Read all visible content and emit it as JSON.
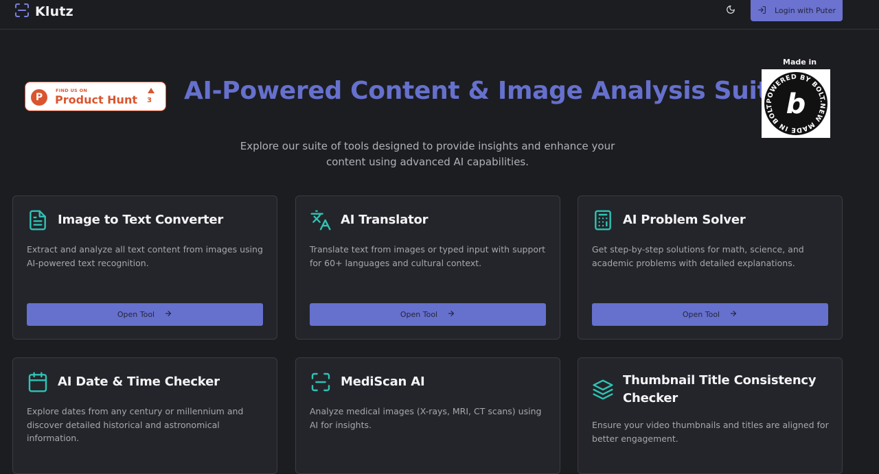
{
  "header": {
    "brand_name": "Klutz",
    "brand_icon": "scan-icon",
    "theme_icon": "moon-icon",
    "login_label": "Login with Puter",
    "login_icon": "login-icon"
  },
  "product_hunt": {
    "top_text": "FIND US ON",
    "name": "Product Hunt",
    "count": "3"
  },
  "hero": {
    "title": "AI-Powered Content & Image Analysis Suite",
    "subtitle": "Explore our suite of tools designed to provide insights and enhance your content using advanced AI capabilities."
  },
  "bolt": {
    "made_in": "Made in",
    "badge_text": "POWERED BY BOLT.NEW MADE IN BOLT.NEW"
  },
  "colors": {
    "accent": "#6670cd",
    "icon_teal": "#2ec4b6",
    "background": "#1c1d21",
    "card": "#23252a"
  },
  "cards": [
    {
      "title": "Image to Text Converter",
      "icon": "document-icon",
      "description": "Extract and analyze all text content from images using AI-powered text recognition.",
      "button": "Open Tool"
    },
    {
      "title": "AI Translator",
      "icon": "translate-icon",
      "description": "Translate text from images or typed input with support for 60+ languages and cultural context.",
      "button": "Open Tool"
    },
    {
      "title": "AI Problem Solver",
      "icon": "calculator-icon",
      "description": "Get step-by-step solutions for math, science, and academic problems with detailed explanations.",
      "button": "Open Tool"
    },
    {
      "title": "AI Date & Time Checker",
      "icon": "calendar-icon",
      "description": "Explore dates from any century or millennium and discover detailed historical and astronomical information."
    },
    {
      "title": "MediScan AI",
      "icon": "scan-icon",
      "description": "Analyze medical images (X-rays, MRI, CT scans) using AI for insights."
    },
    {
      "title": "Thumbnail Title Consistency Checker",
      "icon": "layers-icon",
      "description": "Ensure your video thumbnails and titles are aligned for better engagement."
    }
  ]
}
